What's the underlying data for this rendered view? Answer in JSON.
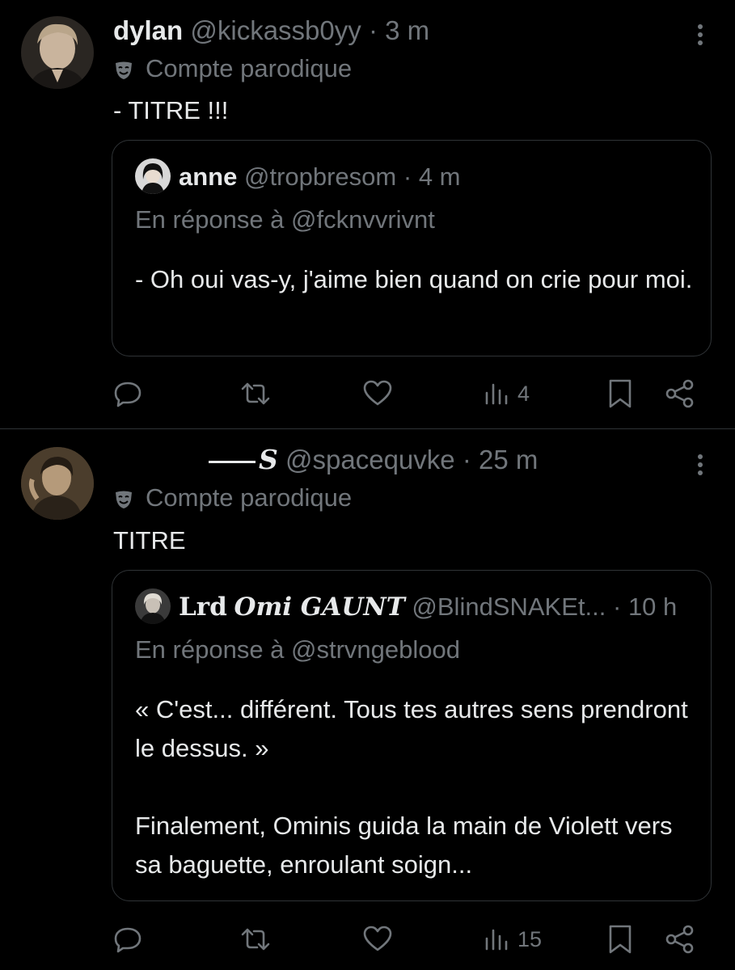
{
  "tweets": [
    {
      "name": "dylan",
      "handle": "@kickassb0yy",
      "dot": "·",
      "time": "3 m",
      "parody_label": "Compte parodique",
      "text": "- TITRE !!!",
      "quote": {
        "name": "anne",
        "handle": "@tropbresom",
        "dot": "·",
        "time": "4 m",
        "reply_to": "En réponse à @fcknvvrivnt",
        "paragraphs": [
          "- Oh oui vas-y, j'aime bien quand on crie pour moi."
        ]
      },
      "views": "4"
    },
    {
      "name_prefix": "——",
      "name": "S",
      "handle": "@spacequvke",
      "dot": "·",
      "time": "25 m",
      "parody_label": "Compte parodique",
      "text": "TITRE",
      "quote": {
        "name_part1": "Lrd",
        "name_part2": "Omi GAUNT",
        "handle": "@BlindSNAKEt...",
        "dot": "·",
        "time": "10 h",
        "reply_to": "En réponse à @strvngeblood",
        "paragraphs": [
          "« C'est... différent. Tous tes autres sens prendront le dessus. »",
          "Finalement, Ominis guida la main de Violett vers sa baguette, enroulant soign..."
        ]
      },
      "views": "15"
    }
  ],
  "icons": {
    "parody": "theater-mask-icon",
    "more": "more-vertical-icon",
    "reply": "reply-icon",
    "retweet": "retweet-icon",
    "like": "heart-icon",
    "views": "views-icon",
    "bookmark": "bookmark-icon",
    "share": "share-icon"
  },
  "colors": {
    "background": "#000000",
    "text": "#e7e9ea",
    "muted": "#71767b",
    "border": "#2f3336"
  }
}
